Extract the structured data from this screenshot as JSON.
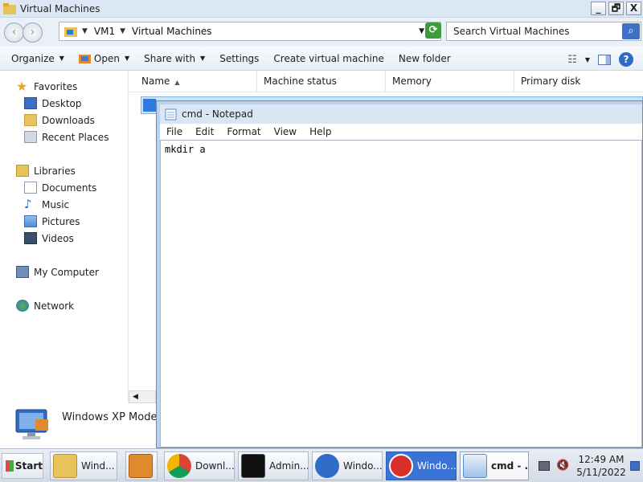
{
  "window": {
    "title": "Virtual Machines",
    "buttons": {
      "minimize": "_",
      "restore": "🗗",
      "close": "X"
    }
  },
  "address": {
    "crumbs": [
      "VM1",
      "Virtual Machines"
    ],
    "search_placeholder": "Search Virtual Machines"
  },
  "toolbar": {
    "organize": "Organize",
    "open": "Open",
    "share_with": "Share with",
    "settings": "Settings",
    "create_vm": "Create virtual machine",
    "new_folder": "New folder"
  },
  "sidebar": {
    "favorites": "Favorites",
    "desktop": "Desktop",
    "downloads": "Downloads",
    "recent_places": "Recent Places",
    "libraries": "Libraries",
    "documents": "Documents",
    "music": "Music",
    "pictures": "Pictures",
    "videos": "Videos",
    "my_computer": "My Computer",
    "network": "Network"
  },
  "columns": {
    "name": "Name",
    "status": "Machine status",
    "memory": "Memory",
    "disk": "Primary disk"
  },
  "details": {
    "label": "Windows XP Mode"
  },
  "notepad": {
    "title": "cmd - Notepad",
    "menu": {
      "file": "File",
      "edit": "Edit",
      "format": "Format",
      "view": "View",
      "help": "Help"
    },
    "content": "mkdir a"
  },
  "taskbar": {
    "start": "Start",
    "tasks": {
      "explorer": "Wind...",
      "chrome": "Downl...",
      "cmd": "Admin...",
      "help": "Windo...",
      "error": "Windo...",
      "notepad": "cmd - ..."
    },
    "clock_time": "12:49 AM",
    "clock_date": "5/11/2022"
  },
  "colors": {
    "accent": "#2f6cc8",
    "selection": "#cde3fa",
    "taskbar": "#d3dbe6"
  }
}
